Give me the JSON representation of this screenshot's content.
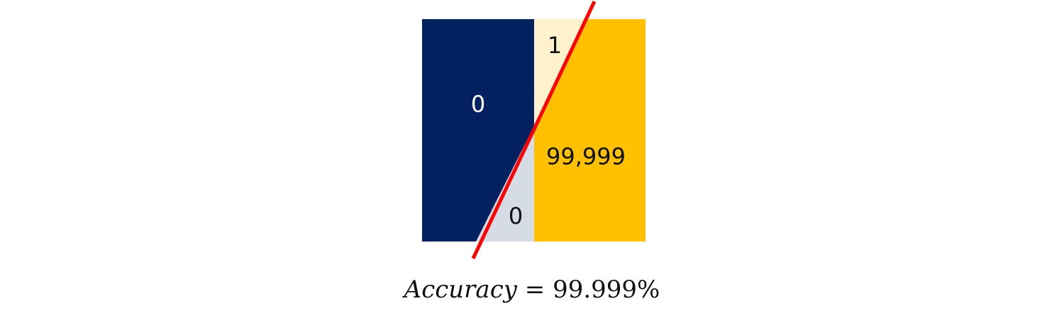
{
  "diagram": {
    "colors": {
      "true_negative_fill": "#03215E",
      "false_negative_fill": "#D6DCE5",
      "false_positive_fill": "#FFF2CC",
      "true_positive_fill": "#FFC000",
      "decision_line": "#FF0000",
      "dark_label_text": "#FFFFFF",
      "light_label_text": "#111111"
    },
    "regions": {
      "true_negative": {
        "label": "0"
      },
      "false_negative": {
        "label": "0"
      },
      "false_positive": {
        "label": "1"
      },
      "true_positive": {
        "label": "99,999"
      }
    }
  },
  "formula": {
    "variable": "Accuracy",
    "equals": "=",
    "value": "99.999%"
  }
}
